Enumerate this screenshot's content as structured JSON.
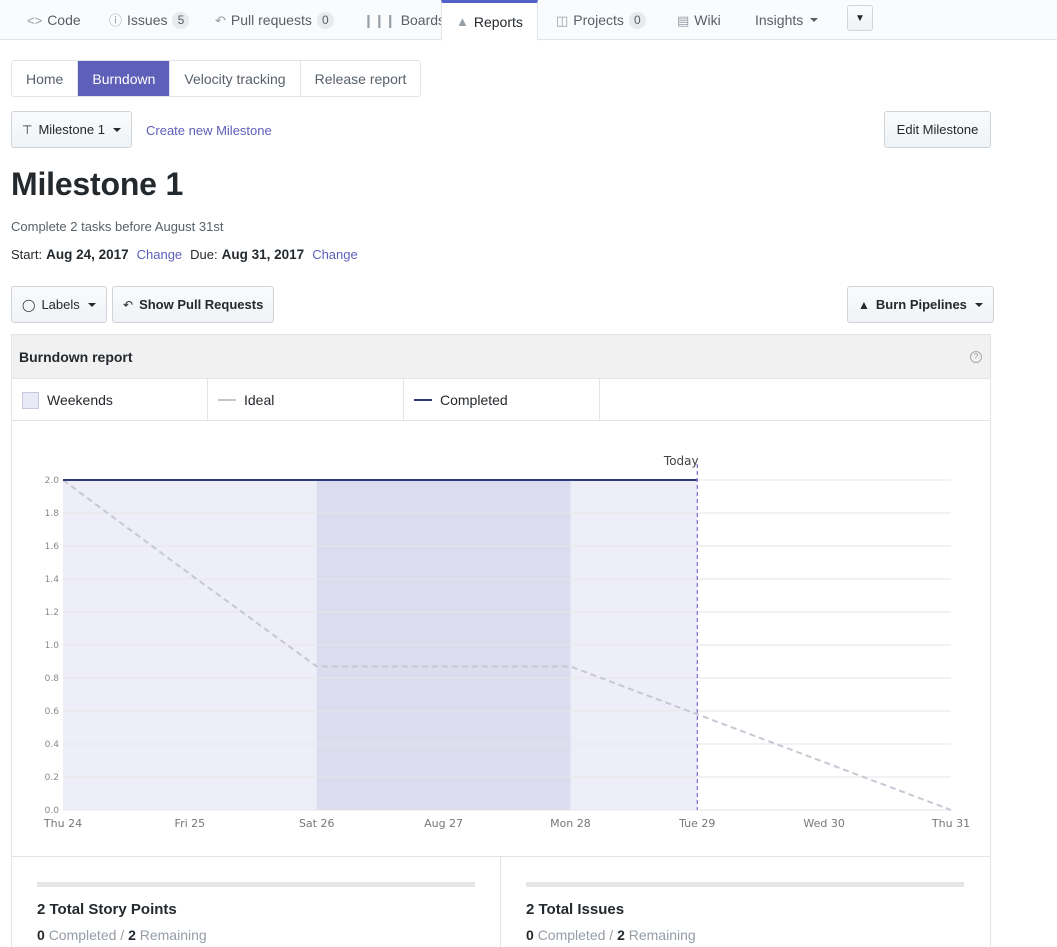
{
  "repo_nav": {
    "tabs": [
      {
        "label": "Code",
        "icon": "code-icon"
      },
      {
        "label": "Issues",
        "icon": "issue-icon",
        "count": "5"
      },
      {
        "label": "Pull requests",
        "icon": "pull-request-icon",
        "count": "0"
      },
      {
        "label": "Boards",
        "icon": "boards-icon"
      },
      {
        "label": "Reports",
        "icon": "reports-icon",
        "selected": true
      },
      {
        "label": "Projects",
        "icon": "projects-icon",
        "count": "0"
      },
      {
        "label": "Wiki",
        "icon": "wiki-icon"
      },
      {
        "label": "Insights",
        "icon": "chevron-down-icon"
      }
    ]
  },
  "subtabs": [
    "Home",
    "Burndown",
    "Velocity tracking",
    "Release report"
  ],
  "subtabs_active": "Burndown",
  "milestone": {
    "selector_label": "Milestone 1",
    "create_link": "Create new Milestone",
    "edit_button": "Edit Milestone",
    "title": "Milestone 1",
    "description": "Complete 2 tasks before August 31st",
    "start_label": "Start:",
    "start_date": "Aug 24, 2017",
    "due_label": "Due:",
    "due_date": "Aug 31, 2017",
    "change_label": "Change"
  },
  "filters": {
    "labels_button": "Labels",
    "pull_requests_button": "Show Pull Requests",
    "burn_pipelines_button": "Burn Pipelines"
  },
  "report": {
    "title": "Burndown report",
    "legend": [
      {
        "label": "Weekends",
        "kind": "box",
        "color": "#eaeaf7"
      },
      {
        "label": "Ideal",
        "kind": "line",
        "color": "#c6c6c6"
      },
      {
        "label": "Completed",
        "kind": "line",
        "color": "#2d3a7c"
      }
    ]
  },
  "chart_data": {
    "type": "line",
    "x": [
      "Thu 24",
      "Fri 25",
      "Sat 26",
      "Aug 27",
      "Mon 28",
      "Tue 29",
      "Wed 30",
      "Thu 31"
    ],
    "ylim": [
      0,
      2.0
    ],
    "yticks": [
      "0.0",
      "0.2",
      "0.4",
      "0.6",
      "0.8",
      "1.0",
      "1.2",
      "1.4",
      "1.6",
      "1.8",
      "2.0"
    ],
    "series": [
      {
        "name": "Ideal",
        "style": "dashed",
        "color": "#c8c8d4",
        "values": [
          2.0,
          1.43,
          0.87,
          0.87,
          0.87,
          0.58,
          0.29,
          0.0
        ]
      },
      {
        "name": "Completed",
        "style": "solid",
        "color": "#2d3a7c",
        "values": [
          2.0,
          2.0,
          2.0,
          2.0,
          2.0,
          2.0
        ]
      }
    ],
    "elapsed_range": [
      0,
      5
    ],
    "weekend_range": [
      2,
      4
    ],
    "today_index": 5,
    "today_label": "Today",
    "colors": {
      "elapsed": "#eeeef8",
      "weekend": "#dcdcef",
      "today": "#7a6ad8",
      "grid": "#e6e6e6"
    },
    "grid": true
  },
  "stats": [
    {
      "title": "2 Total Story Points",
      "completed_value": "0",
      "completed_label": "Completed",
      "remaining_value": "2",
      "remaining_label": "Remaining",
      "progress": 0
    },
    {
      "title": "2 Total Issues",
      "completed_value": "0",
      "completed_label": "Completed",
      "remaining_value": "2",
      "remaining_label": "Remaining",
      "progress": 0
    }
  ]
}
